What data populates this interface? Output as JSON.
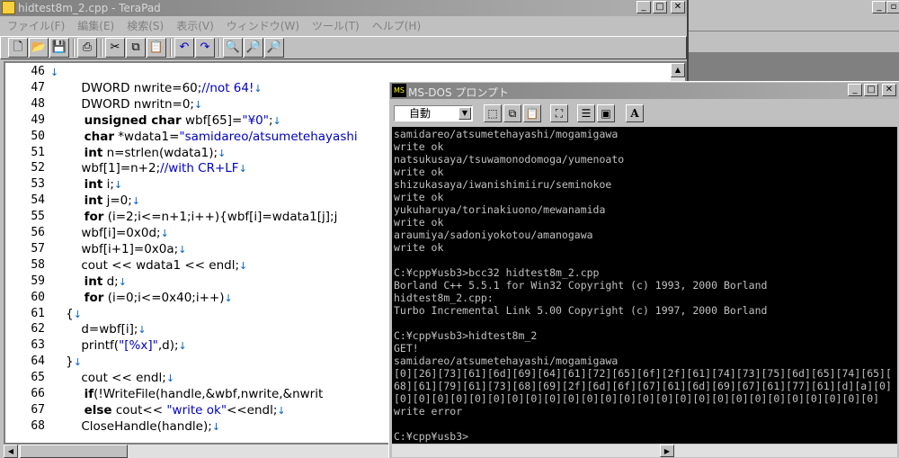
{
  "terapad": {
    "title": "hidtest8m_2.cpp - TeraPad",
    "menu": [
      "ファイル(F)",
      "編集(E)",
      "検索(S)",
      "表示(V)",
      "ウィンドウ(W)",
      "ツール(T)",
      "ヘルプ(H)"
    ],
    "toolbar_icons": [
      "new-file-icon",
      "open-folder-icon",
      "save-icon",
      "print-icon",
      "cut-icon",
      "copy-icon",
      "paste-icon",
      "undo-icon",
      "redo-icon",
      "find-icon",
      "find-prev-icon",
      "find-next-icon"
    ],
    "line_numbers": [
      "46",
      "47",
      "48",
      "49",
      "50",
      "51",
      "52",
      "53",
      "54",
      "55",
      "56",
      "57",
      "58",
      "59",
      "60",
      "61",
      "62",
      "63",
      "64",
      "65",
      "66",
      "67",
      "68"
    ],
    "lines": [
      [
        {
          "t": "",
          "c": ""
        },
        {
          "t": "↓",
          "c": "nl"
        }
      ],
      [
        {
          "t": "        DWORD nwrite=60;",
          "c": ""
        },
        {
          "t": "//not 64!",
          "c": "cm"
        },
        {
          "t": "↓",
          "c": "nl"
        }
      ],
      [
        {
          "t": "        DWORD nwritn=0;",
          "c": ""
        },
        {
          "t": "↓",
          "c": "nl"
        }
      ],
      [
        {
          "t": "        unsigned char",
          "c": "kw"
        },
        {
          "t": " wbf[65]=",
          "c": ""
        },
        {
          "t": "\"¥0\"",
          "c": "st"
        },
        {
          "t": ";",
          "c": ""
        },
        {
          "t": "↓",
          "c": "nl"
        }
      ],
      [
        {
          "t": "        char",
          "c": "kw"
        },
        {
          "t": " *wdata1=",
          "c": ""
        },
        {
          "t": "\"samidareo/atsumetehayashi",
          "c": "st"
        }
      ],
      [
        {
          "t": "        int",
          "c": "kw"
        },
        {
          "t": " n=strlen(wdata1);",
          "c": ""
        },
        {
          "t": "↓",
          "c": "nl"
        }
      ],
      [
        {
          "t": "        wbf[1]=n+2;",
          "c": ""
        },
        {
          "t": "//with CR+LF",
          "c": "cm"
        },
        {
          "t": "↓",
          "c": "nl"
        }
      ],
      [
        {
          "t": "        int",
          "c": "kw"
        },
        {
          "t": " i;",
          "c": ""
        },
        {
          "t": "↓",
          "c": "nl"
        }
      ],
      [
        {
          "t": "        int",
          "c": "kw"
        },
        {
          "t": " j=0;",
          "c": ""
        },
        {
          "t": "↓",
          "c": "nl"
        }
      ],
      [
        {
          "t": "        for",
          "c": "kw"
        },
        {
          "t": " (i=2;i<=n+1;i++){wbf[i]=wdata1[j];j",
          "c": ""
        }
      ],
      [
        {
          "t": "        wbf[i]=0x0d;",
          "c": ""
        },
        {
          "t": "↓",
          "c": "nl"
        }
      ],
      [
        {
          "t": "        wbf[i+1]=0x0a;",
          "c": ""
        },
        {
          "t": "↓",
          "c": "nl"
        }
      ],
      [
        {
          "t": "        cout << wdata1 << endl;",
          "c": ""
        },
        {
          "t": "↓",
          "c": "nl"
        }
      ],
      [
        {
          "t": "        int",
          "c": "kw"
        },
        {
          "t": " d;",
          "c": ""
        },
        {
          "t": "↓",
          "c": "nl"
        }
      ],
      [
        {
          "t": "        for",
          "c": "kw"
        },
        {
          "t": " (i=0;i<=0x40;i++)",
          "c": ""
        },
        {
          "t": "↓",
          "c": "nl"
        }
      ],
      [
        {
          "t": "    {",
          "c": ""
        },
        {
          "t": "↓",
          "c": "nl"
        }
      ],
      [
        {
          "t": "        d=wbf[i];",
          "c": ""
        },
        {
          "t": "↓",
          "c": "nl"
        }
      ],
      [
        {
          "t": "        printf(",
          "c": ""
        },
        {
          "t": "\"[%x]\"",
          "c": "st"
        },
        {
          "t": ",d);",
          "c": ""
        },
        {
          "t": "↓",
          "c": "nl"
        }
      ],
      [
        {
          "t": "    }",
          "c": ""
        },
        {
          "t": "↓",
          "c": "nl"
        }
      ],
      [
        {
          "t": "        cout << endl;",
          "c": ""
        },
        {
          "t": "↓",
          "c": "nl"
        }
      ],
      [
        {
          "t": "        if",
          "c": "kw"
        },
        {
          "t": "(!WriteFile(handle,&wbf,nwrite,&nwrit",
          "c": ""
        }
      ],
      [
        {
          "t": "        else",
          "c": "kw"
        },
        {
          "t": " cout<< ",
          "c": ""
        },
        {
          "t": "\"write ok\"",
          "c": "st"
        },
        {
          "t": "<<endl;",
          "c": ""
        },
        {
          "t": "↓",
          "c": "nl"
        }
      ],
      [
        {
          "t": "        CloseHandle(handle);",
          "c": ""
        },
        {
          "t": "↓",
          "c": "nl"
        }
      ]
    ]
  },
  "dos": {
    "title": "MS-DOS プロンプト",
    "font_select": "自動",
    "lines": [
      "samidareo/atsumetehayashi/mogamigawa",
      "write ok",
      "natsukusaya/tsuwamonodomoga/yumenoato",
      "write ok",
      "shizukasaya/iwanishimiiru/seminokoe",
      "write ok",
      "yukuharuya/torinakiuono/mewanamida",
      "write ok",
      "araumiya/sadoniyokotou/amanogawa",
      "write ok",
      "",
      "C:¥cpp¥usb3>bcc32 hidtest8m_2.cpp",
      "Borland C++ 5.5.1 for Win32 Copyright (c) 1993, 2000 Borland",
      "hidtest8m_2.cpp:",
      "Turbo Incremental Link 5.00 Copyright (c) 1997, 2000 Borland",
      "",
      "C:¥cpp¥usb3>hidtest8m_2",
      "GET!",
      "samidareo/atsumetehayashi/mogamigawa",
      "[0][26][73][61][6d][69][64][61][72][65][6f][2f][61][74][73][75][6d][65][74][65][",
      "68][61][79][61][73][68][69][2f][6d][6f][67][61][6d][69][67][61][77][61][d][a][0]",
      "[0][0][0][0][0][0][0][0][0][0][0][0][0][0][0][0][0][0][0][0][0][0][0][0][0][0]",
      "write error",
      "",
      "C:¥cpp¥usb3>"
    ]
  }
}
